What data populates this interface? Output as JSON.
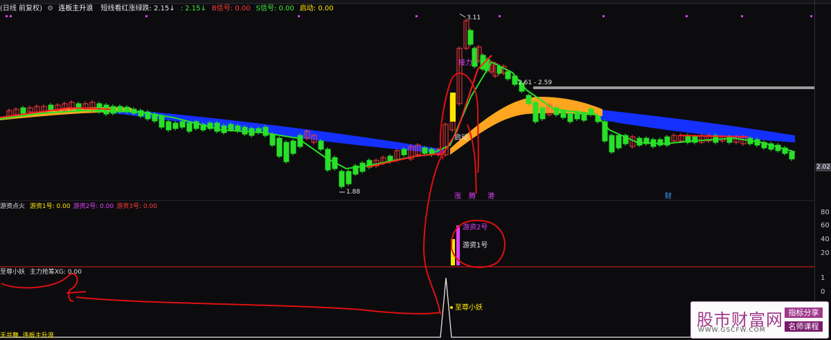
{
  "indicator_main": {
    "name": "连板主升浪",
    "items": [
      {
        "label": "短线看红涨绿跌:",
        "value": "2.15",
        "arrow": "↓",
        "color": "#e8e8e8"
      },
      {
        "label": ":",
        "value": "2.15",
        "arrow": "↓",
        "color": "#3cf03c"
      },
      {
        "label": "B信号:",
        "value": "0.00",
        "color": "#ff3b3b"
      },
      {
        "label": "S信号:",
        "value": "0.00",
        "color": "#3cf03c"
      },
      {
        "label": "启动:",
        "value": "0.00",
        "color": "#ffe600"
      }
    ],
    "period_label": "(日线 前复权)"
  },
  "indicator_sub1": {
    "name": "游资点火",
    "items": [
      {
        "label": "游资1号:",
        "value": "0.00",
        "color": "#ffe600"
      },
      {
        "label": "游资2号:",
        "value": "0.00",
        "color": "#e040fb"
      },
      {
        "label": "游资3号:",
        "value": "0.00",
        "color": "#ff3b3b"
      }
    ]
  },
  "indicator_sub2": {
    "name": "至尊小妖",
    "items": [
      {
        "label": "主力抢筹XG:",
        "value": "0.00",
        "color": "#e0e0e0"
      }
    ]
  },
  "bottom_label": "天共舞, 连板主升浪",
  "chart_annotations": {
    "high_price": "3.11",
    "low_price": "1.88",
    "range_label": "2.61 - 2.59",
    "current_price": "2.02",
    "qidong_label": "启动",
    "jieli_label": "接力",
    "zhang_label": "涨",
    "teng_label": "腾",
    "gang_label": "港",
    "cai_label": "财",
    "youzi1_label": "游资1号",
    "youzi2_label": "游资2号",
    "zhizun_label": "至尊小妖"
  },
  "sub1_ticks": [
    "80",
    "60",
    "40",
    "20"
  ],
  "sub2_ticks": [
    "1",
    "0"
  ],
  "watermark": {
    "title": "股市财富网",
    "url": "WWW.GSCFW.COM",
    "tag1": "指标分享",
    "tag2": "名师课程"
  },
  "colors": {
    "up": "#ff3b3b",
    "down": "#28e028",
    "orange_band": "#ffa51f",
    "blue_band": "#1430ff",
    "resistance": "#9a9a9a",
    "annotation_red": "#e01010"
  },
  "chart_data": {
    "type": "candlestick",
    "price_high": 3.11,
    "price_low": 1.88,
    "price_current": 2.02,
    "resistance_range": [
      2.61,
      2.59
    ],
    "sub1_ylim": [
      0,
      90
    ],
    "sub2_ylim": [
      0,
      1.5
    ]
  }
}
